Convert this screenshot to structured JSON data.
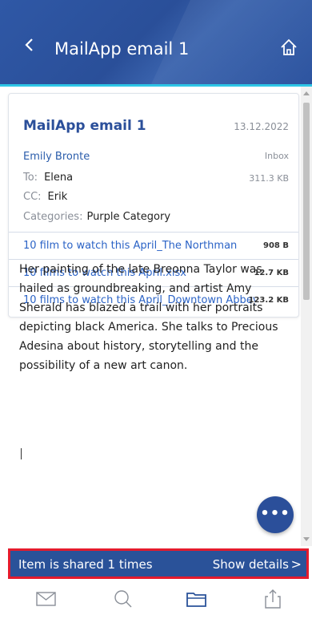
{
  "header": {
    "title": "MailApp email 1",
    "back_icon": "chevron-left-icon",
    "home_icon": "home-icon"
  },
  "email": {
    "subject": "MailApp email 1",
    "date": "13.12.2022",
    "sender": "Emily Bronte",
    "folder": "Inbox",
    "to_label": "To:",
    "to_value": "Elena",
    "size": "311.3 KB",
    "cc_label": "CC:",
    "cc_value": "Erik",
    "categories_label": "Categories:",
    "categories_value": "Purple Category"
  },
  "attachments": [
    {
      "name": "10 film to watch this April_The Northman",
      "size": "908 B"
    },
    {
      "name": "10 films to watch this April.xlsx",
      "size": "12.7 KB"
    },
    {
      "name": "10 films to watch this April_Downtown Abbey",
      "size": "123.2 KB"
    }
  ],
  "body": {
    "text": "Her painting of the late Breonna Taylor was hailed as groundbreaking, and artist Amy Sherald has blazed a trail with her portraits depicting black America. She talks to Precious Adesina about history, storytelling and the possibility of a new art canon."
  },
  "fab": {
    "label": "•••"
  },
  "share": {
    "text": "Item is shared 1 times",
    "action": "Show details",
    "chevron": ">"
  },
  "bottom_nav": [
    {
      "icon": "mail-icon"
    },
    {
      "icon": "search-icon"
    },
    {
      "icon": "folder-icon"
    },
    {
      "icon": "share-icon"
    }
  ],
  "colors": {
    "header": "#2f58a6",
    "accent_line": "#2ec6e6",
    "link": "#2b63c6",
    "sharebar": "#2a5299",
    "highlight_border": "#e41b2d"
  }
}
